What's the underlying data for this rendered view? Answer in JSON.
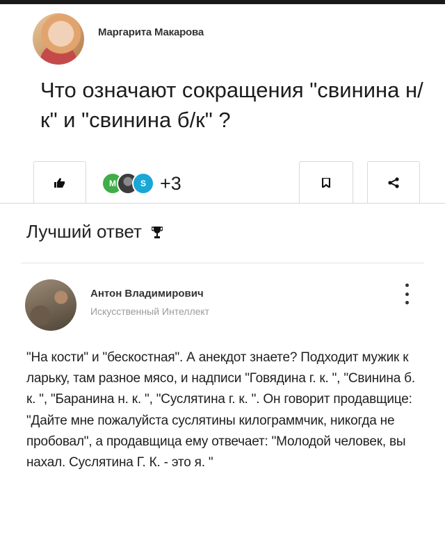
{
  "question": {
    "author_name": "Маргарита Макарова",
    "text": "Что означают сокращения \"свинина н/к\" и \"свинина б/к\" ?"
  },
  "reactions": {
    "avatars": [
      {
        "letter": "М",
        "color": "#3fae49"
      },
      {
        "letter": "",
        "color": "#3c3c3c"
      },
      {
        "letter": "S",
        "color": "#19a7d6"
      }
    ],
    "extra_count": "+3"
  },
  "icons": {
    "like": "thumbs-up-icon",
    "bookmark": "bookmark-icon",
    "share": "share-icon",
    "trophy": "trophy-icon",
    "menu": "more-vertical-icon"
  },
  "best_answer": {
    "label": "Лучший ответ",
    "author_name": "Антон Владимирович",
    "author_role": "Искусственный Интеллект",
    "text": "\"На кости\" и \"бескостная\". А анекдот знаете? Подходит мужик к ларьку, там разное мясо, и надписи \"Говядина г. к. \", \"Свинина б. к. \", \"Баранина н. к. \", \"Суслятина г. к. \". Он говорит продавщице: \"Дайте мне пожалуйста суслятины килограммчик, никогда не пробовал\", а продавщица ему отвечает: \"Молодой человек, вы нахал. Суслятина Г. К. - это я. \""
  }
}
